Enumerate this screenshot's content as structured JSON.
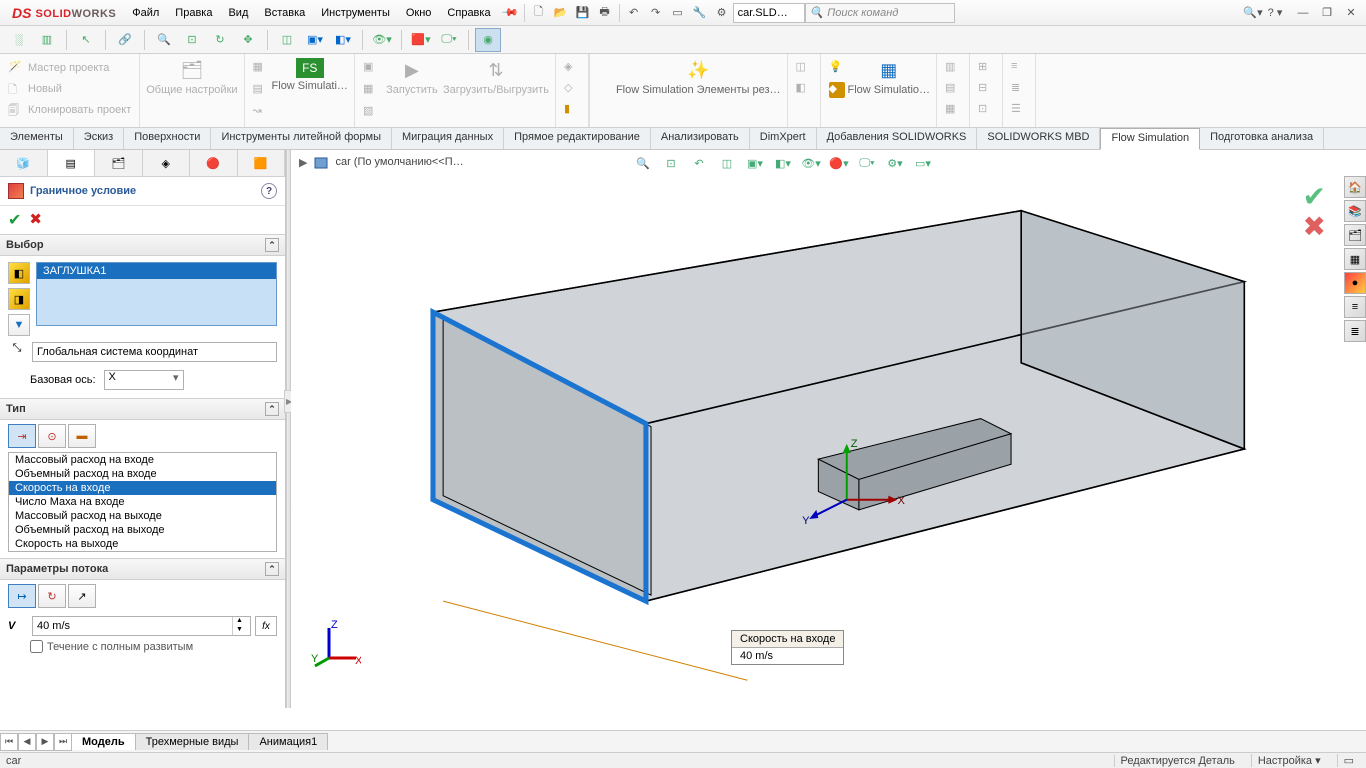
{
  "app": {
    "brand_solid": "SOLID",
    "brand_works": "WORKS",
    "ds": "DS"
  },
  "menu": [
    "Файл",
    "Правка",
    "Вид",
    "Вставка",
    "Инструменты",
    "Окно",
    "Справка"
  ],
  "doc_name": "car.SLD…",
  "search_placeholder": "Поиск команд",
  "ribbon": {
    "left_list": [
      "Мастер проекта",
      "Новый",
      "Клонировать проект"
    ],
    "settings": "Общие настройки",
    "flowsim": "Flow Simulati…",
    "run": "Запустить",
    "load": "Загрузить/Выгрузить",
    "fs_menu": "Flow Simulation Элементы рез…",
    "fs_big": "Flow Simulatio…"
  },
  "cm_tabs": [
    "Элементы",
    "Эскиз",
    "Поверхности",
    "Инструменты литейной формы",
    "Миграция данных",
    "Прямое редактирование",
    "Анализировать",
    "DimXpert",
    "Добавления SOLIDWORKS",
    "SOLIDWORKS MBD",
    "Flow Simulation",
    "Подготовка анализа"
  ],
  "cm_active": "Flow Simulation",
  "breadcrumb": "car  (По умолчанию<<П…",
  "pm": {
    "title": "Граничное условие",
    "section_sel": "Выбор",
    "sel_item": "ЗАГЛУШКА1",
    "cs_value": "Глобальная система координат",
    "axis_label": "Базовая ось:",
    "axis_value": "X",
    "section_type": "Тип",
    "bc_options": [
      "Массовый расход на входе",
      "Объемный расход на входе",
      "Скорость на входе",
      "Число Маха на входе",
      "Массовый расход на выходе",
      "Объемный расход на выходе",
      "Скорость на выходе"
    ],
    "bc_selected": "Скорость на входе",
    "section_flow": "Параметры потока",
    "vel_symbol": "V",
    "vel_value": "40 m/s",
    "fx": "fx",
    "chk": "Течение с полным развитым"
  },
  "anno": {
    "title": "Скорость на входе",
    "value": "40 m/s"
  },
  "bottom_tabs": [
    "Модель",
    "Трехмерные виды",
    "Анимация1"
  ],
  "status": {
    "doc": "car",
    "edit": "Редактируется Деталь",
    "custom": "Настройка"
  },
  "triad": {
    "x": "X",
    "y": "Y",
    "z": "Z"
  },
  "scene_triad": {
    "x": "X",
    "y": "Y",
    "z": "Z"
  }
}
